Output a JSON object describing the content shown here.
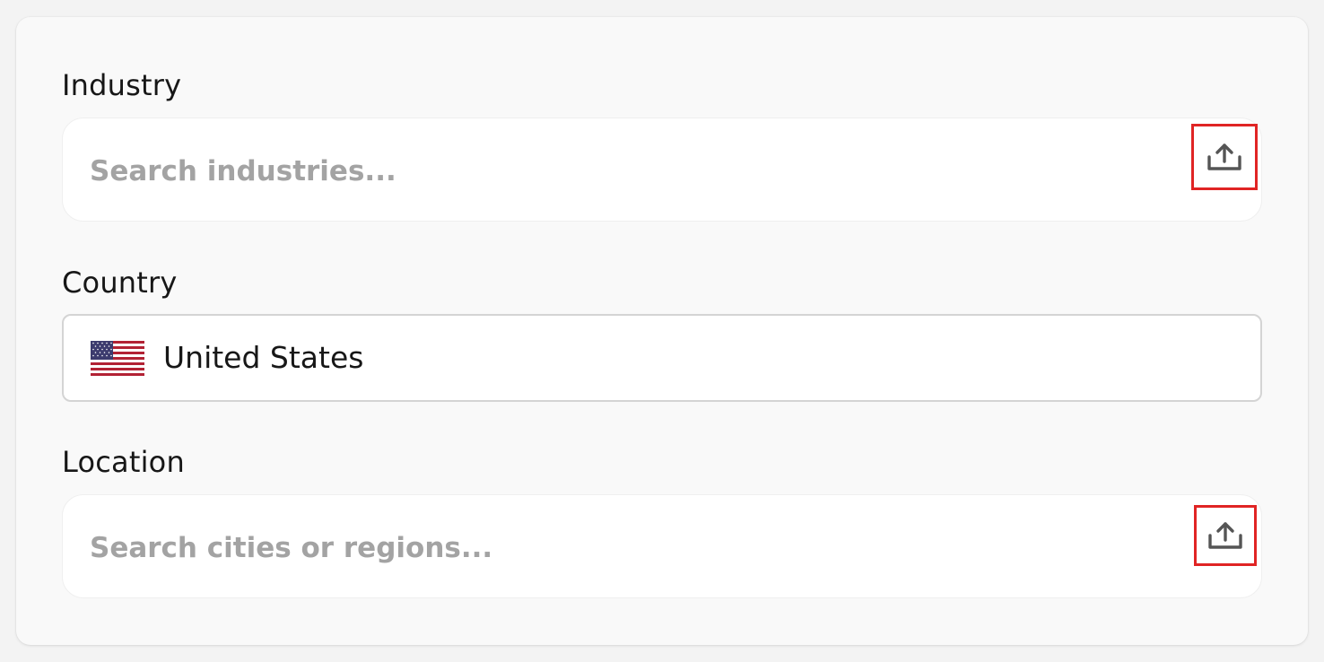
{
  "form": {
    "industry": {
      "label": "Industry",
      "placeholder": "Search industries...",
      "action_icon": "upload-icon"
    },
    "country": {
      "label": "Country",
      "selected_value": "United States",
      "flag_icon": "us-flag-icon"
    },
    "location": {
      "label": "Location",
      "placeholder": "Search cities or regions...",
      "action_icon": "upload-icon"
    }
  },
  "colors": {
    "placeholder_text": "#a3a3a3",
    "highlight_border": "#e02424",
    "card_background": "#f9f9f9"
  }
}
